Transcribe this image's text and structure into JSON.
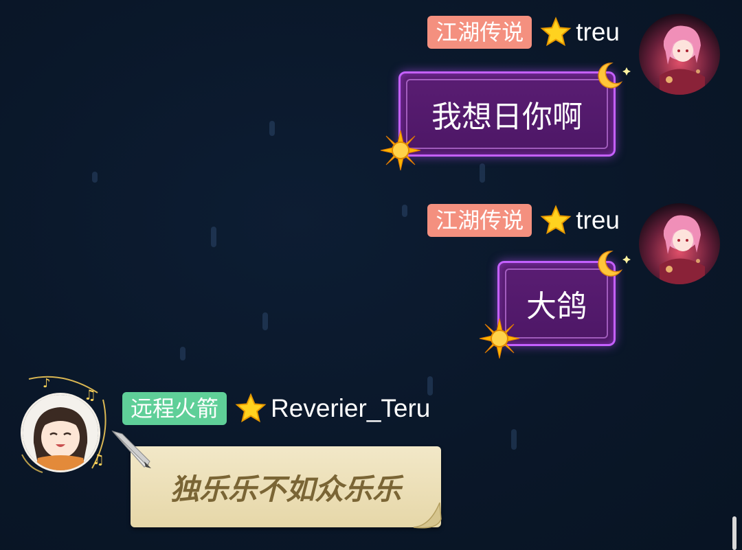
{
  "messages": [
    {
      "side": "right",
      "badge": "江湖传说",
      "badge_color": "#f4907f",
      "username": "treu",
      "text": "我想日你啊",
      "bubble_style": "purple-frame"
    },
    {
      "side": "right",
      "badge": "江湖传说",
      "badge_color": "#f4907f",
      "username": "treu",
      "text": "大鸽",
      "bubble_style": "purple-frame"
    },
    {
      "side": "left",
      "badge": "远程火箭",
      "badge_color": "#5fcf98",
      "username": "Reverier_Teru",
      "text": "独乐乐不如众乐乐",
      "bubble_style": "parchment"
    }
  ],
  "icons": {
    "rank": "star-icon",
    "moon": "crescent-moon-icon",
    "sun": "sun-icon",
    "quill": "quill-pen-icon"
  },
  "colors": {
    "background": "#0a1729",
    "purple_bubble": "#4f1868",
    "purple_border": "#c560ff",
    "parchment": "#ece0b8",
    "parchment_text": "#7a6535"
  }
}
